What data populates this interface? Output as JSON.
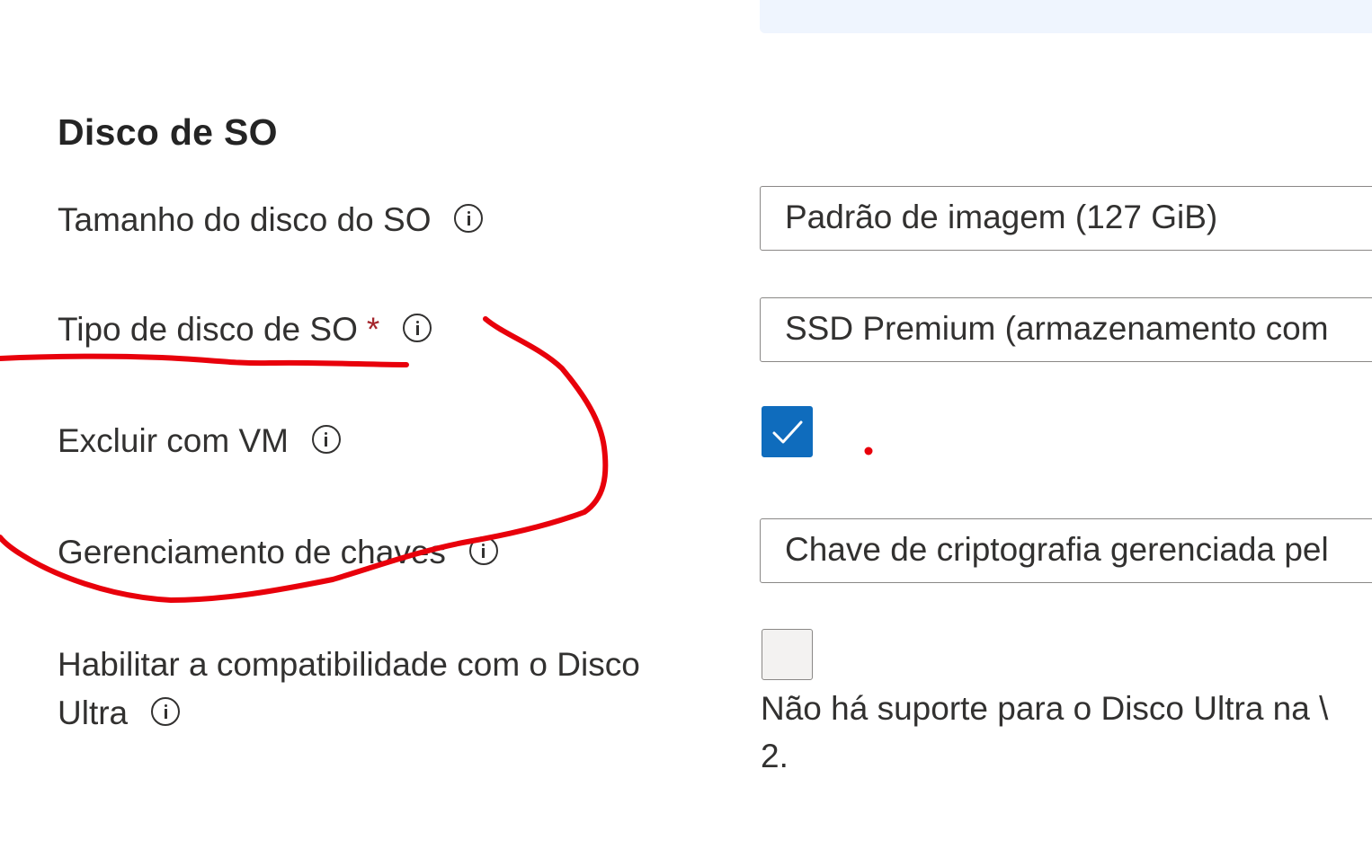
{
  "section": {
    "title": "Disco de SO"
  },
  "fields": {
    "os_disk_size": {
      "label": "Tamanho do disco do SO",
      "value": "Padrão de imagem (127 GiB)"
    },
    "os_disk_type": {
      "label": "Tipo de disco de SO",
      "required_mark": "*",
      "value": "SSD Premium (armazenamento com"
    },
    "delete_with_vm": {
      "label": "Excluir com VM",
      "checked": true
    },
    "key_management": {
      "label": "Gerenciamento de chaves",
      "value": "Chave de criptografia gerenciada pel"
    },
    "ultra_disk": {
      "label_line1": "Habilitar a compatibilidade com o Disco",
      "label_line2": "Ultra",
      "checked": false,
      "note_line1": "Não há suporte para o Disco Ultra na \\",
      "note_line2": "2."
    }
  },
  "colors": {
    "accent": "#0f6cbd",
    "required": "#a4262c",
    "annotation": "#e8000b",
    "banner": "#eff5fe"
  },
  "icons": [
    "info-icon",
    "checkmark-icon"
  ]
}
